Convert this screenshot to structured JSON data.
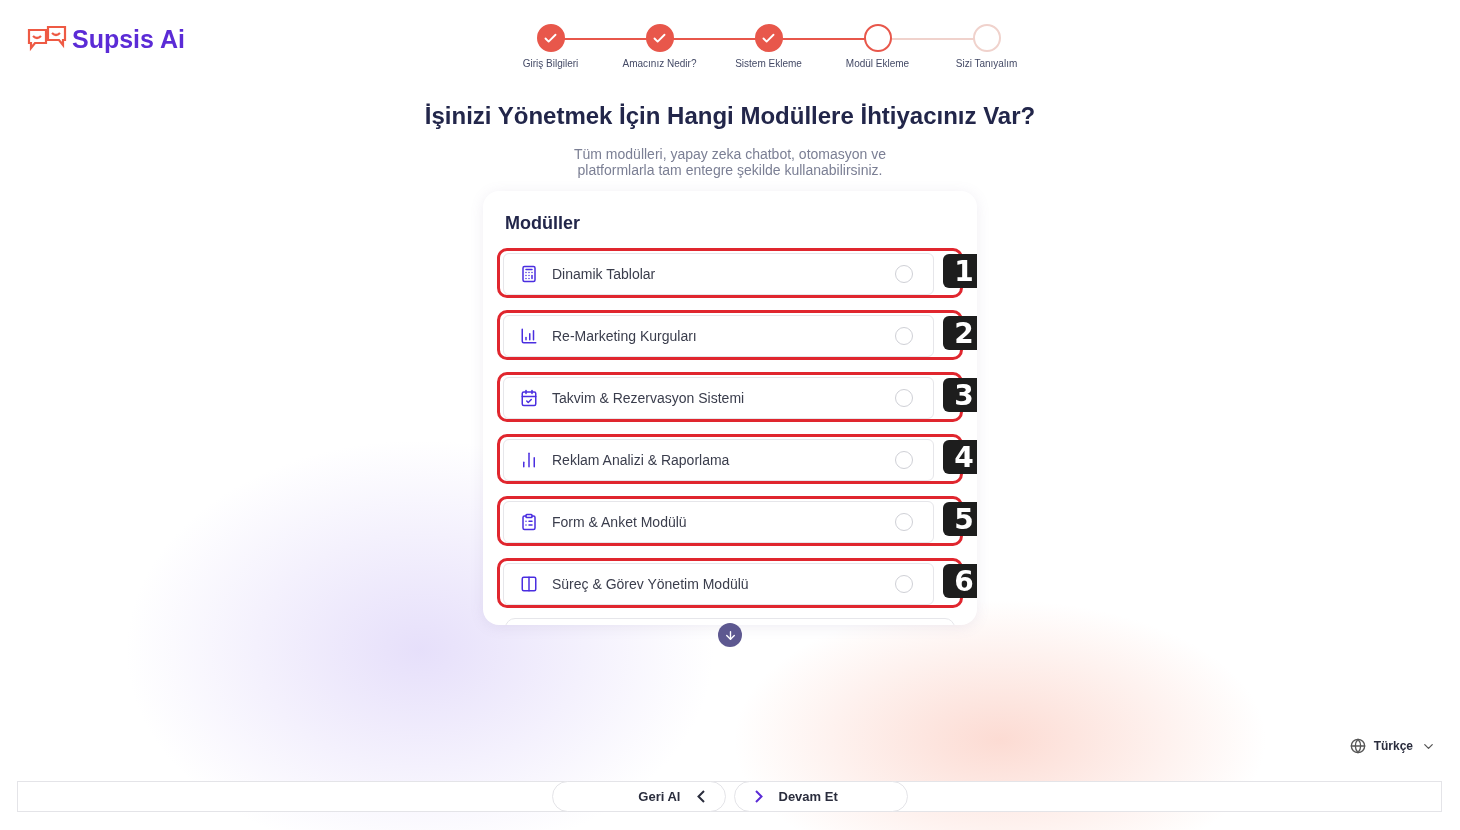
{
  "logo": {
    "text": "Supsis Ai"
  },
  "steps": [
    {
      "label": "Giriş Bilgileri",
      "completed": true,
      "current": false
    },
    {
      "label": "Amacınız Nedir?",
      "completed": true,
      "current": false
    },
    {
      "label": "Sistem Ekleme",
      "completed": true,
      "current": false
    },
    {
      "label": "Modül Ekleme",
      "completed": false,
      "current": true
    },
    {
      "label": "Sizi Tanıyalım",
      "completed": false,
      "current": false
    }
  ],
  "title": "İşinizi Yönetmek İçin Hangi Modüllere İhtiyacınız Var?",
  "subtitle": "Tüm modülleri, yapay zeka chatbot, otomasyon ve platformlarla tam entegre şekilde kullanabilirsiniz.",
  "card": {
    "heading": "Modüller",
    "modules": [
      {
        "label": "Dinamik Tablolar",
        "selected": false,
        "marker": "1"
      },
      {
        "label": "Re-Marketing Kurguları",
        "selected": false,
        "marker": "2"
      },
      {
        "label": "Takvim & Rezervasyon Sistemi",
        "selected": false,
        "marker": "3"
      },
      {
        "label": "Reklam Analizi & Raporlama",
        "selected": false,
        "marker": "4"
      },
      {
        "label": "Form & Anket Modülü",
        "selected": false,
        "marker": "5"
      },
      {
        "label": "Süreç & Görev Yönetim Modülü",
        "selected": false,
        "marker": "6"
      }
    ]
  },
  "language": {
    "label": "Türkçe"
  },
  "footer": {
    "back": "Geri Al",
    "next": "Devam Et"
  }
}
